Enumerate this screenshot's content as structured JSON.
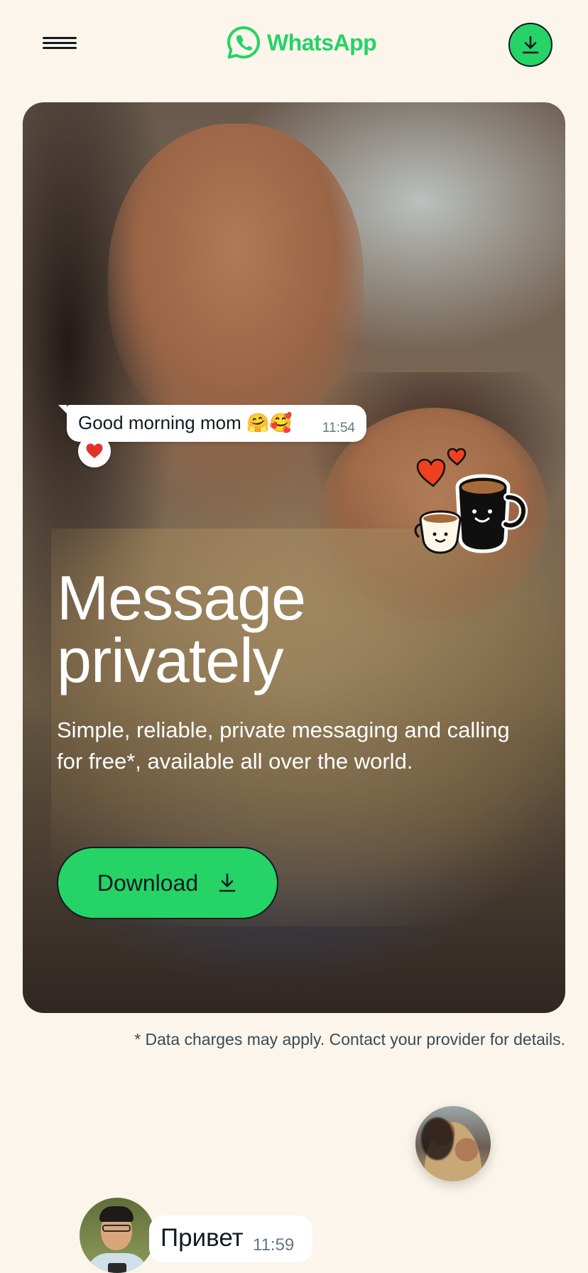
{
  "header": {
    "brand": "WhatsApp",
    "menu_icon": "hamburger-menu-icon",
    "download_icon": "download-arrow-icon"
  },
  "hero": {
    "chat": {
      "message": "Good morning mom 🤗🥰",
      "time": "11:54",
      "reaction": "❤️"
    },
    "title_line1": "Message",
    "title_line2": "privately",
    "subtitle": "Simple, reliable, private messaging and calling for free*, available all over the world.",
    "download_label": "Download"
  },
  "disclaimer": "* Data charges may apply. Contact your provider for details.",
  "preview_chat": {
    "message": "Привет",
    "time": "11:59"
  },
  "colors": {
    "brand_green": "#25d366",
    "background": "#fcf5eb",
    "ink": "#111b21",
    "time_gray": "#667781"
  }
}
